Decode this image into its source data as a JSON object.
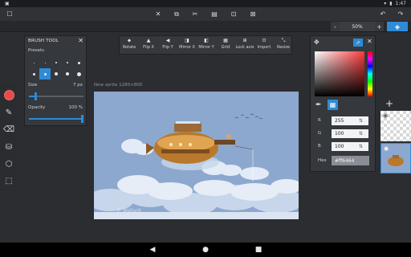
{
  "status": {
    "time": "1:47",
    "left_icon": "image-icon"
  },
  "toolbar": {
    "icons": [
      "menu-icon",
      "undo-icon",
      "redo-icon",
      "layers-icon"
    ]
  },
  "zoom": {
    "minus": "-",
    "value": "50%",
    "plus": "+"
  },
  "brush_panel": {
    "title": "BRUSH TOOL",
    "presets_label": "Presets",
    "size_label": "Size",
    "size_value": "7 px",
    "size_fraction": 0.12,
    "opacity_label": "Opacity",
    "opacity_value": "100 %",
    "opacity_fraction": 1.0,
    "selected_preset": 6
  },
  "transform": {
    "items": [
      {
        "label": "Rotate",
        "icon": "rotate-icon"
      },
      {
        "label": "Flip X",
        "icon": "flip-x-icon"
      },
      {
        "label": "Flip Y",
        "icon": "flip-y-icon"
      },
      {
        "label": "Mirror X",
        "icon": "mirror-x-icon"
      },
      {
        "label": "Mirror Y",
        "icon": "mirror-y-icon"
      },
      {
        "label": "Grid",
        "icon": "grid-icon"
      },
      {
        "label": "Lock axis",
        "icon": "lock-axis-icon"
      },
      {
        "label": "Import",
        "icon": "import-icon"
      },
      {
        "label": "Resize",
        "icon": "resize-icon"
      }
    ]
  },
  "canvas": {
    "label": "New sprite 1280×800",
    "watermark": "© Wellard"
  },
  "color": {
    "r_label": "R",
    "r": "255",
    "g_label": "G",
    "g": "100",
    "b_label": "B",
    "b": "100",
    "hex_label": "Hex",
    "hex": "#ff6464",
    "accent": "#2e8bd6"
  },
  "layers": {
    "add": "+"
  }
}
